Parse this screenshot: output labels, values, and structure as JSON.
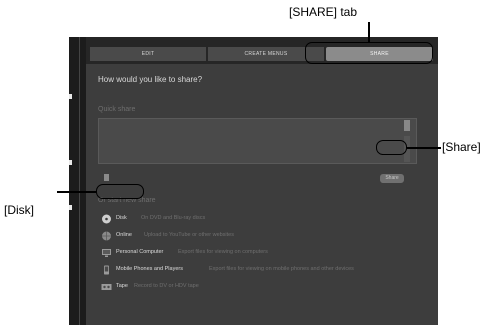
{
  "tabs": {
    "edit": "EDIT",
    "create_menus": "CREATE MENUS",
    "share": "SHARE"
  },
  "main": {
    "heading": "How would you like to share?",
    "quick_share": {
      "title": "Quick share",
      "share_button": "Share"
    },
    "new_share": {
      "title": "Or start new share",
      "items": [
        {
          "name": "Disk",
          "desc": "On DVD and Blu-ray discs",
          "icon": "disc-icon"
        },
        {
          "name": "Online",
          "desc": "Upload to YouTube or other websites",
          "icon": "globe-icon"
        },
        {
          "name": "Personal Computer",
          "desc": "Export files for viewing on computers",
          "icon": "monitor-icon"
        },
        {
          "name": "Mobile Phones and Players",
          "desc": "Export files for viewing on mobile phones and other devices",
          "icon": "phone-icon"
        },
        {
          "name": "Tape",
          "desc": "Record to DV or HDV tape",
          "icon": "tape-icon"
        }
      ]
    }
  },
  "annotations": {
    "share_tab": "[SHARE] tab",
    "share": "[Share]",
    "disk": "[Disk]"
  },
  "colors": {
    "panel": "#3d3d3d",
    "tabbar": "#262626",
    "active_tab": "#8b8b8b"
  }
}
